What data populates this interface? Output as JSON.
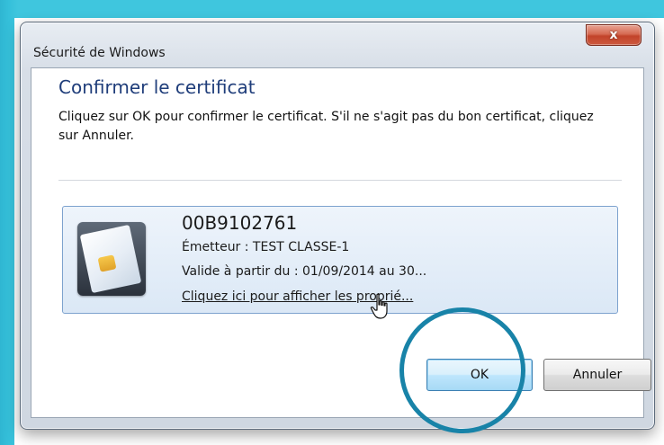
{
  "window": {
    "title": "Sécurité de Windows",
    "close_glyph": "x"
  },
  "dialog": {
    "heading": "Confirmer le certificat",
    "instructions": "Cliquez sur OK pour confirmer le certificat. S'il ne s'agit pas du bon certificat, cliquez sur Annuler."
  },
  "certificate": {
    "serial": "00B9102761",
    "issuer": "Émetteur : TEST CLASSE-1",
    "validity": "Valide à partir du : 01/09/2014 au 30...",
    "properties_link": "Cliquez ici pour afficher les proprié..."
  },
  "buttons": {
    "ok": "OK",
    "cancel": "Annuler"
  },
  "icons": {
    "close": "close-icon",
    "certificate": "smart-card-icon",
    "cursor": "hand-cursor-icon"
  },
  "colors": {
    "background": "#35bcd6",
    "heading": "#1f3d7a",
    "highlight_ring": "#1883a8",
    "close_button": "#c2432a"
  }
}
